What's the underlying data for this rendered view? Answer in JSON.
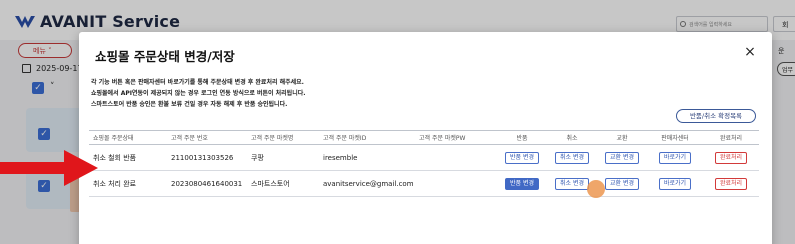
{
  "app": {
    "title": "AVANIT Service",
    "search_placeholder": "검색어를 입력하세요",
    "top_right_label": "회",
    "menu_label": "메뉴",
    "date": "2025-09-17",
    "right_side_text": "운",
    "right_side_button": "업무"
  },
  "modal": {
    "title": "쇼핑몰 주문상태 변경/저장",
    "close_label": "×",
    "notices": [
      "각 기능 버튼 혹은 판매자센터 바로가기를 통해 주문상태 변경 후 완료처리 해주세요.",
      "쇼핑몰에서 API연동이 제공되지 않는 경우 로그인 연동 방식으로 버튼이 처리됩니다.",
      "스마트스토어 반품 승인은 환불 보류 건일 경우 자동 해제 후 반품 승인됩니다."
    ],
    "return_cancel_list_button": "반품/취소 확정목록"
  },
  "table": {
    "columns": [
      "쇼핑몰 주문상태",
      "고객 주문 번호",
      "고객 주문 마켓명",
      "고객 주문 마켓ID",
      "고객 주문 마켓PW",
      "반품",
      "취소",
      "교환",
      "판매자센터",
      "완료처리"
    ],
    "rows": [
      {
        "status": "취소 철회 반품",
        "order_no": "21100131303526",
        "market": "쿠팡",
        "market_id": "iresemble",
        "market_pw": "",
        "return_btn": "반품 변경",
        "cancel_btn": "취소 변경",
        "exchange_btn": "교환 변경",
        "seller_btn": "바로가기",
        "complete_btn": "완료처리"
      },
      {
        "status": "취소 처리 완료",
        "order_no": "2023080461640031",
        "market": "스마트스토어",
        "market_id": "avanitservice@gmail.com",
        "market_pw": "",
        "return_btn": "반품 변경",
        "cancel_btn": "취소 변경",
        "exchange_btn": "교환 변경",
        "seller_btn": "바로가기",
        "complete_btn": "완료처리"
      }
    ]
  },
  "colors": {
    "accent": "#4169c5",
    "danger": "#d23a3a",
    "arrow": "#e0161b",
    "cursor": "#ec9650"
  },
  "icons": [
    "logo-icon",
    "search-icon",
    "calendar-icon",
    "close-icon",
    "checkbox-icon",
    "chevron-down-icon",
    "arrow-pointer-icon",
    "cursor-highlight-icon"
  ]
}
